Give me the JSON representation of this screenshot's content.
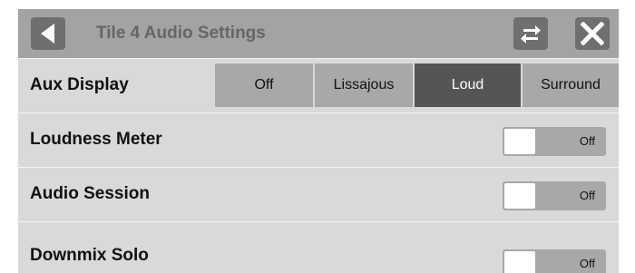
{
  "header": {
    "title": "Tile 4 Audio Settings",
    "back_icon": "back-arrow-icon",
    "swap_icon": "swap-icon",
    "close_icon": "close-icon"
  },
  "settings": {
    "aux_display": {
      "label": "Aux Display",
      "options": [
        "Off",
        "Lissajous",
        "Loud",
        "Surround"
      ],
      "selected": "Loud"
    },
    "loudness_meter": {
      "label": "Loudness Meter",
      "state": "Off"
    },
    "audio_session": {
      "label": "Audio Session",
      "state": "Off"
    },
    "downmix_solo": {
      "label": "Downmix Solo",
      "state": "Off"
    }
  },
  "colors": {
    "titlebar": "#a3a3a3",
    "panel": "#d9d9d9",
    "segment": "#a8a8a8",
    "segment_active": "#555555"
  }
}
